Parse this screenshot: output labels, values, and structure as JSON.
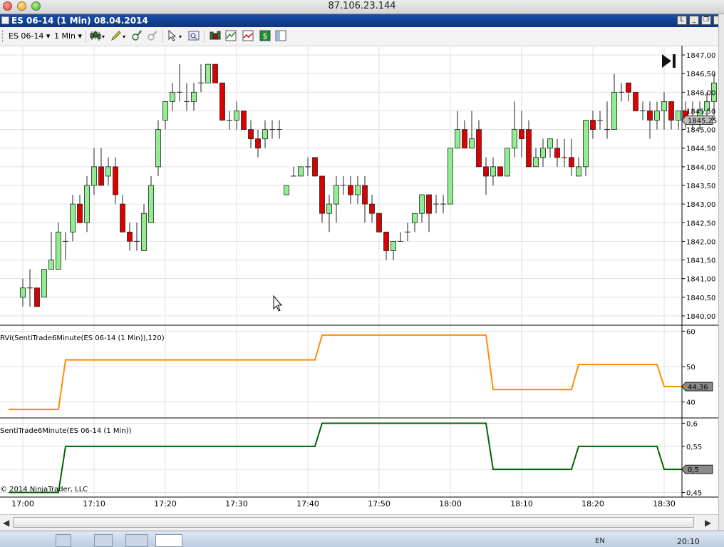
{
  "window": {
    "host": "87.106.23.144",
    "title": "ES 06-14 (1 Min)  08.04.2014",
    "buttons": [
      "L",
      "❐",
      "✕"
    ]
  },
  "toolbar": {
    "instrument": "ES 06-14",
    "interval": "1 Min",
    "icons": [
      "candlestick-icon",
      "pencil-icon",
      "zoom-in-icon",
      "zoom-out-icon",
      "cursor-icon",
      "properties-icon",
      "bar-type-icon",
      "indicators-icon",
      "strategy-icon",
      "chart-trader-icon"
    ]
  },
  "taskbar": {
    "lang": "EN",
    "clock": "20:10"
  },
  "chart_data": [
    {
      "type": "candlestick",
      "panel": "price",
      "x_tick_labels": [
        "17:00",
        "17:10",
        "17:20",
        "17:30",
        "17:40",
        "17:50",
        "18:00",
        "18:10",
        "18:20",
        "18:30"
      ],
      "y_tick_labels": [
        "1847,00",
        "1846,50",
        "1846,00",
        "1845,50",
        "1845,00",
        "1844,50",
        "1844,00",
        "1843,50",
        "1843,00",
        "1842,50",
        "1842,00",
        "1841,50",
        "1841,00",
        "1840,50",
        "1840,00"
      ],
      "ylim": [
        1839.75,
        1847.25
      ],
      "last_price_label": "1845,25",
      "candles": [
        {
          "t": "17:00",
          "o": 1840.5,
          "h": 1841.0,
          "l": 1840.25,
          "c": 1840.75
        },
        {
          "t": "17:01",
          "o": 1840.75,
          "h": 1841.25,
          "l": 1840.25,
          "c": 1840.75
        },
        {
          "t": "17:02",
          "o": 1840.75,
          "h": 1840.75,
          "l": 1840.25,
          "c": 1840.25
        },
        {
          "t": "17:03",
          "o": 1840.5,
          "h": 1841.25,
          "l": 1840.5,
          "c": 1841.25
        },
        {
          "t": "17:04",
          "o": 1841.25,
          "h": 1842.25,
          "l": 1841.25,
          "c": 1841.5
        },
        {
          "t": "17:05",
          "o": 1841.25,
          "h": 1842.5,
          "l": 1841.25,
          "c": 1842.25
        },
        {
          "t": "17:06",
          "o": 1842.0,
          "h": 1842.25,
          "l": 1841.5,
          "c": 1842.0
        },
        {
          "t": "17:07",
          "o": 1842.25,
          "h": 1843.25,
          "l": 1842.0,
          "c": 1843.0
        },
        {
          "t": "17:08",
          "o": 1843.0,
          "h": 1843.25,
          "l": 1842.5,
          "c": 1842.5
        },
        {
          "t": "17:09",
          "o": 1842.5,
          "h": 1843.75,
          "l": 1842.25,
          "c": 1843.5
        },
        {
          "t": "17:10",
          "o": 1843.5,
          "h": 1844.5,
          "l": 1843.25,
          "c": 1844.0
        },
        {
          "t": "17:11",
          "o": 1844.0,
          "h": 1844.5,
          "l": 1843.5,
          "c": 1843.5
        },
        {
          "t": "17:12",
          "o": 1843.75,
          "h": 1844.25,
          "l": 1843.5,
          "c": 1844.0
        },
        {
          "t": "17:13",
          "o": 1844.0,
          "h": 1844.25,
          "l": 1843.0,
          "c": 1843.25
        },
        {
          "t": "17:14",
          "o": 1843.0,
          "h": 1843.25,
          "l": 1842.25,
          "c": 1842.25
        },
        {
          "t": "17:15",
          "o": 1842.25,
          "h": 1842.5,
          "l": 1841.75,
          "c": 1842.0
        },
        {
          "t": "17:16",
          "o": 1842.0,
          "h": 1842.5,
          "l": 1841.75,
          "c": 1842.0
        },
        {
          "t": "17:17",
          "o": 1841.75,
          "h": 1843.0,
          "l": 1841.75,
          "c": 1842.75
        },
        {
          "t": "17:18",
          "o": 1842.5,
          "h": 1843.75,
          "l": 1842.5,
          "c": 1843.5
        },
        {
          "t": "17:19",
          "o": 1844.0,
          "h": 1845.25,
          "l": 1843.75,
          "c": 1845.0
        },
        {
          "t": "17:20",
          "o": 1845.25,
          "h": 1845.75,
          "l": 1845.0,
          "c": 1845.75
        },
        {
          "t": "17:21",
          "o": 1845.75,
          "h": 1846.25,
          "l": 1845.5,
          "c": 1846.0
        },
        {
          "t": "17:22",
          "o": 1846.0,
          "h": 1846.75,
          "l": 1845.75,
          "c": 1846.0
        },
        {
          "t": "17:23",
          "o": 1845.75,
          "h": 1846.25,
          "l": 1845.5,
          "c": 1845.75
        },
        {
          "t": "17:24",
          "o": 1845.75,
          "h": 1846.25,
          "l": 1845.5,
          "c": 1846.0
        },
        {
          "t": "17:25",
          "o": 1846.25,
          "h": 1846.75,
          "l": 1846.0,
          "c": 1846.25
        },
        {
          "t": "17:26",
          "o": 1846.25,
          "h": 1846.75,
          "l": 1846.25,
          "c": 1846.75
        },
        {
          "t": "17:27",
          "o": 1846.75,
          "h": 1846.75,
          "l": 1846.25,
          "c": 1846.25
        },
        {
          "t": "17:28",
          "o": 1846.25,
          "h": 1846.25,
          "l": 1845.25,
          "c": 1845.25
        },
        {
          "t": "17:29",
          "o": 1845.25,
          "h": 1845.5,
          "l": 1845.0,
          "c": 1845.25
        },
        {
          "t": "17:30",
          "o": 1845.25,
          "h": 1845.75,
          "l": 1845.0,
          "c": 1845.5
        },
        {
          "t": "17:31",
          "o": 1845.5,
          "h": 1845.5,
          "l": 1845.0,
          "c": 1845.0
        },
        {
          "t": "17:32",
          "o": 1845.0,
          "h": 1845.25,
          "l": 1844.5,
          "c": 1844.75
        },
        {
          "t": "17:33",
          "o": 1844.75,
          "h": 1845.0,
          "l": 1844.25,
          "c": 1844.5
        },
        {
          "t": "17:34",
          "o": 1844.75,
          "h": 1845.25,
          "l": 1844.5,
          "c": 1845.0
        },
        {
          "t": "17:35",
          "o": 1845.0,
          "h": 1845.25,
          "l": 1844.75,
          "c": 1845.0
        },
        {
          "t": "17:36",
          "o": 1845.0,
          "h": 1845.25,
          "l": 1844.75,
          "c": 1845.0
        },
        {
          "t": "17:37",
          "o": 1843.25,
          "h": 1843.5,
          "l": 1843.25,
          "c": 1843.5
        },
        {
          "t": "17:38",
          "o": 1843.75,
          "h": 1844.0,
          "l": 1843.75,
          "c": 1843.75
        },
        {
          "t": "17:39",
          "o": 1843.75,
          "h": 1844.0,
          "l": 1843.75,
          "c": 1844.0
        },
        {
          "t": "17:40",
          "o": 1844.0,
          "h": 1844.25,
          "l": 1843.75,
          "c": 1844.0
        },
        {
          "t": "17:41",
          "o": 1844.25,
          "h": 1844.25,
          "l": 1843.75,
          "c": 1843.75
        },
        {
          "t": "17:42",
          "o": 1843.75,
          "h": 1843.75,
          "l": 1842.5,
          "c": 1842.75
        },
        {
          "t": "17:43",
          "o": 1842.75,
          "h": 1843.25,
          "l": 1842.25,
          "c": 1843.0
        },
        {
          "t": "17:44",
          "o": 1843.0,
          "h": 1843.75,
          "l": 1842.5,
          "c": 1843.5
        },
        {
          "t": "17:45",
          "o": 1843.5,
          "h": 1843.75,
          "l": 1843.25,
          "c": 1843.5
        },
        {
          "t": "17:46",
          "o": 1843.5,
          "h": 1843.75,
          "l": 1843.0,
          "c": 1843.25
        },
        {
          "t": "17:47",
          "o": 1843.25,
          "h": 1843.75,
          "l": 1843.0,
          "c": 1843.5
        },
        {
          "t": "17:48",
          "o": 1843.5,
          "h": 1843.75,
          "l": 1842.5,
          "c": 1843.0
        },
        {
          "t": "17:49",
          "o": 1843.0,
          "h": 1843.25,
          "l": 1842.5,
          "c": 1842.75
        },
        {
          "t": "17:50",
          "o": 1842.75,
          "h": 1842.75,
          "l": 1842.25,
          "c": 1842.25
        },
        {
          "t": "17:51",
          "o": 1842.25,
          "h": 1842.25,
          "l": 1841.5,
          "c": 1841.75
        },
        {
          "t": "17:52",
          "o": 1841.75,
          "h": 1842.0,
          "l": 1841.5,
          "c": 1842.0
        },
        {
          "t": "17:53",
          "o": 1842.0,
          "h": 1842.25,
          "l": 1842.0,
          "c": 1842.0
        },
        {
          "t": "17:54",
          "o": 1842.25,
          "h": 1842.5,
          "l": 1842.0,
          "c": 1842.25
        },
        {
          "t": "17:55",
          "o": 1842.5,
          "h": 1842.75,
          "l": 1842.25,
          "c": 1842.75
        },
        {
          "t": "17:56",
          "o": 1842.75,
          "h": 1843.25,
          "l": 1842.5,
          "c": 1843.25
        },
        {
          "t": "17:57",
          "o": 1843.25,
          "h": 1843.25,
          "l": 1842.25,
          "c": 1842.75
        },
        {
          "t": "17:58",
          "o": 1843.0,
          "h": 1843.25,
          "l": 1842.75,
          "c": 1843.0
        },
        {
          "t": "17:59",
          "o": 1843.0,
          "h": 1843.25,
          "l": 1842.75,
          "c": 1843.0
        },
        {
          "t": "18:00",
          "o": 1843.0,
          "h": 1844.5,
          "l": 1843.0,
          "c": 1844.5
        },
        {
          "t": "18:01",
          "o": 1844.5,
          "h": 1845.5,
          "l": 1844.5,
          "c": 1845.0
        },
        {
          "t": "18:02",
          "o": 1845.0,
          "h": 1845.25,
          "l": 1844.5,
          "c": 1844.5
        },
        {
          "t": "18:03",
          "o": 1844.5,
          "h": 1845.5,
          "l": 1844.5,
          "c": 1844.75
        },
        {
          "t": "18:04",
          "o": 1845.0,
          "h": 1845.25,
          "l": 1844.0,
          "c": 1844.0
        },
        {
          "t": "18:05",
          "o": 1844.0,
          "h": 1844.25,
          "l": 1843.25,
          "c": 1843.75
        },
        {
          "t": "18:06",
          "o": 1843.75,
          "h": 1844.25,
          "l": 1843.5,
          "c": 1844.0
        },
        {
          "t": "18:07",
          "o": 1844.0,
          "h": 1844.0,
          "l": 1843.75,
          "c": 1843.75
        },
        {
          "t": "18:08",
          "o": 1843.75,
          "h": 1844.5,
          "l": 1843.75,
          "c": 1844.5
        },
        {
          "t": "18:09",
          "o": 1844.5,
          "h": 1845.75,
          "l": 1844.25,
          "c": 1845.0
        },
        {
          "t": "18:10",
          "o": 1845.0,
          "h": 1845.5,
          "l": 1844.25,
          "c": 1844.75
        },
        {
          "t": "18:11",
          "o": 1845.0,
          "h": 1845.25,
          "l": 1844.0,
          "c": 1844.0
        },
        {
          "t": "18:12",
          "o": 1844.0,
          "h": 1844.5,
          "l": 1844.0,
          "c": 1844.25
        },
        {
          "t": "18:13",
          "o": 1844.25,
          "h": 1844.75,
          "l": 1844.0,
          "c": 1844.5
        },
        {
          "t": "18:14",
          "o": 1844.5,
          "h": 1844.75,
          "l": 1844.25,
          "c": 1844.75
        },
        {
          "t": "18:15",
          "o": 1844.5,
          "h": 1844.75,
          "l": 1844.0,
          "c": 1844.25
        },
        {
          "t": "18:16",
          "o": 1844.25,
          "h": 1844.75,
          "l": 1844.0,
          "c": 1844.25
        },
        {
          "t": "18:17",
          "o": 1844.25,
          "h": 1844.75,
          "l": 1843.75,
          "c": 1844.0
        },
        {
          "t": "18:18",
          "o": 1843.75,
          "h": 1844.25,
          "l": 1843.75,
          "c": 1844.0
        },
        {
          "t": "18:19",
          "o": 1844.0,
          "h": 1845.25,
          "l": 1843.75,
          "c": 1845.25
        },
        {
          "t": "18:20",
          "o": 1845.25,
          "h": 1845.5,
          "l": 1844.75,
          "c": 1845.0
        },
        {
          "t": "18:21",
          "o": 1845.25,
          "h": 1845.5,
          "l": 1845.0,
          "c": 1845.25
        },
        {
          "t": "18:22",
          "o": 1845.0,
          "h": 1845.75,
          "l": 1844.75,
          "c": 1845.0
        },
        {
          "t": "18:23",
          "o": 1845.0,
          "h": 1846.5,
          "l": 1845.0,
          "c": 1846.0
        },
        {
          "t": "18:24",
          "o": 1846.0,
          "h": 1846.25,
          "l": 1845.75,
          "c": 1846.0
        },
        {
          "t": "18:25",
          "o": 1846.25,
          "h": 1846.25,
          "l": 1845.75,
          "c": 1846.0
        },
        {
          "t": "18:26",
          "o": 1846.0,
          "h": 1846.0,
          "l": 1845.5,
          "c": 1845.5
        },
        {
          "t": "18:27",
          "o": 1845.5,
          "h": 1845.75,
          "l": 1845.25,
          "c": 1845.5
        },
        {
          "t": "18:28",
          "o": 1845.5,
          "h": 1845.75,
          "l": 1844.75,
          "c": 1845.25
        },
        {
          "t": "18:29",
          "o": 1845.25,
          "h": 1845.75,
          "l": 1845.0,
          "c": 1845.5
        },
        {
          "t": "18:30",
          "o": 1845.5,
          "h": 1846.0,
          "l": 1845.0,
          "c": 1845.75
        },
        {
          "t": "18:31",
          "o": 1845.75,
          "h": 1845.75,
          "l": 1845.0,
          "c": 1845.25
        },
        {
          "t": "18:32",
          "o": 1845.25,
          "h": 1845.5,
          "l": 1845.0,
          "c": 1845.5
        },
        {
          "t": "18:33",
          "o": 1845.5,
          "h": 1845.75,
          "l": 1845.0,
          "c": 1845.25
        },
        {
          "t": "18:34",
          "o": 1845.25,
          "h": 1845.75,
          "l": 1845.0,
          "c": 1845.25
        },
        {
          "t": "18:35",
          "o": 1845.25,
          "h": 1845.75,
          "l": 1845.0,
          "c": 1845.5
        },
        {
          "t": "18:36",
          "o": 1845.5,
          "h": 1846.0,
          "l": 1845.25,
          "c": 1845.75
        },
        {
          "t": "18:37",
          "o": 1845.75,
          "h": 1846.5,
          "l": 1845.25,
          "c": 1846.25
        },
        {
          "t": "18:38",
          "o": 1846.25,
          "h": 1846.25,
          "l": 1845.5,
          "c": 1845.5
        },
        {
          "t": "18:39",
          "o": 1845.5,
          "h": 1846.0,
          "l": 1845.5,
          "c": 1845.5
        },
        {
          "t": "18:40",
          "o": 1845.5,
          "h": 1845.75,
          "l": 1845.0,
          "c": 1845.5
        },
        {
          "t": "18:41",
          "o": 1845.5,
          "h": 1845.75,
          "l": 1845.0,
          "c": 1845.75
        },
        {
          "t": "18:42",
          "o": 1845.5,
          "h": 1845.75,
          "l": 1845.0,
          "c": 1845.25
        }
      ],
      "colors": {
        "up": "#90ee90",
        "down": "#dd0000",
        "wick": "#222222"
      }
    },
    {
      "type": "line",
      "panel": "rvi",
      "label": "RVI(SentiTrade6Minute(ES 06-14 (1 Min)),120)",
      "y_tick_labels": [
        "60",
        "50",
        "40"
      ],
      "ylim": [
        35.5,
        61.5
      ],
      "last_value_label": "44,36",
      "color": "#ff8c00",
      "x": [
        "17:00",
        "17:05",
        "17:06",
        "17:41",
        "17:42",
        "18:05",
        "18:06",
        "18:17",
        "18:18",
        "18:29",
        "18:30",
        "18:35"
      ],
      "values": [
        37.9,
        37.9,
        51.9,
        51.9,
        58.9,
        58.9,
        43.5,
        43.5,
        50.6,
        50.6,
        44.36,
        44.36
      ]
    },
    {
      "type": "line",
      "panel": "sentitrade",
      "label": "SentiTrade6Minute(ES 06-14 (1 Min))",
      "y_tick_labels": [
        "0,6",
        "0,55",
        "0,5",
        "0,45"
      ],
      "ylim": [
        0.44,
        0.61
      ],
      "last_value_label": "0,5",
      "color": "#006400",
      "x": [
        "17:00",
        "17:05",
        "17:06",
        "17:41",
        "17:42",
        "18:05",
        "18:06",
        "18:17",
        "18:18",
        "18:29",
        "18:30",
        "18:35"
      ],
      "values": [
        0.45,
        0.45,
        0.55,
        0.55,
        0.6,
        0.6,
        0.5,
        0.5,
        0.55,
        0.55,
        0.5,
        0.5
      ]
    }
  ],
  "copyright": "© 2014 NinjaTrader, LLC"
}
